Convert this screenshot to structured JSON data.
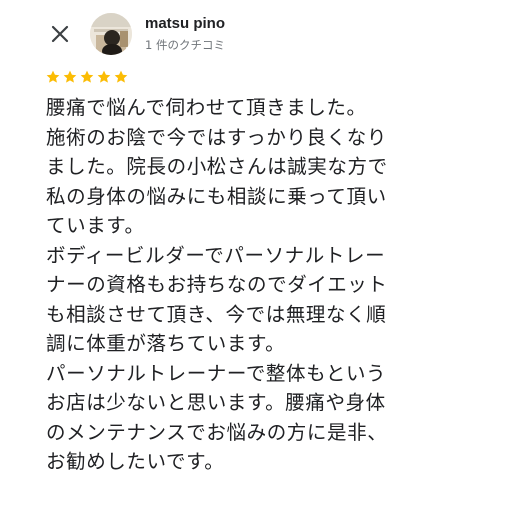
{
  "header": {
    "close_icon": "close-icon",
    "avatar_icon": "avatar",
    "author_name": "matsu pino",
    "author_meta": "1 件のクチコミ"
  },
  "rating": {
    "stars": 5,
    "max": 5,
    "color": "#fbbc04"
  },
  "review": {
    "lines": [
      "腰痛で悩んで伺わせて頂きました。",
      "施術のお陰で今ではすっかり良くなり",
      "ました。院長の小松さんは誠実な方で",
      "私の身体の悩みにも相談に乗って頂い",
      "ています。",
      "ボディービルダーでパーソナルトレー",
      "ナーの資格もお持ちなのでダイエット",
      "も相談させて頂き、今では無理なく順",
      "調に体重が落ちています。",
      "パーソナルトレーナーで整体もという",
      "お店は少ないと思います。腰痛や身体",
      "のメンテナンスでお悩みの方に是非、",
      "お勧めしたいです。"
    ]
  }
}
